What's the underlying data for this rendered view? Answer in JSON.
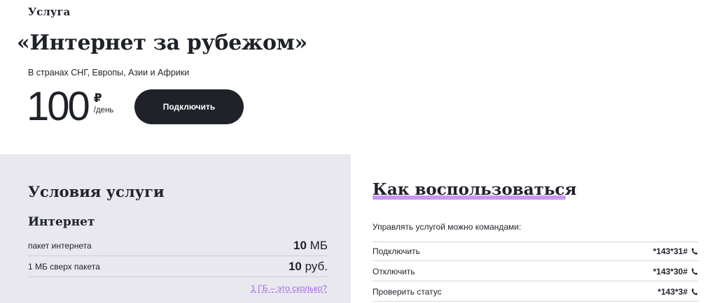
{
  "header": {
    "eyebrow": "Услуга",
    "title": "«Интернет за рубежом»",
    "subtitle": "В странах СНГ, Европы, Азии и Африки"
  },
  "price": {
    "value": "100",
    "currency": "₽",
    "period": "/день"
  },
  "actions": {
    "connect_label": "Подключить"
  },
  "conditions": {
    "title": "Условия услуги",
    "section": "Интернет",
    "rows": [
      {
        "label": "пакет интернета",
        "value_bold": "10",
        "value_unit": " МБ"
      },
      {
        "label": "1 МБ сверх пакета",
        "value_bold": "10",
        "value_unit": " руб."
      }
    ],
    "gb_link": "1 ГБ – это сколько?"
  },
  "how_to": {
    "title": "Как воспользоваться",
    "intro": "Управлять услугой можно командами:",
    "commands": [
      {
        "label": "Подключить",
        "code": "*143*31#"
      },
      {
        "label": "Отключить",
        "code": "*143*30#"
      },
      {
        "label": "Проверить статус",
        "code": "*143*3#"
      }
    ]
  },
  "colors": {
    "dark": "#1f2229",
    "panel": "#e8e8ee",
    "accent_purple": "#c897f5",
    "link_purple": "#a56ae6"
  },
  "icons": {
    "phone": "phone-icon"
  }
}
